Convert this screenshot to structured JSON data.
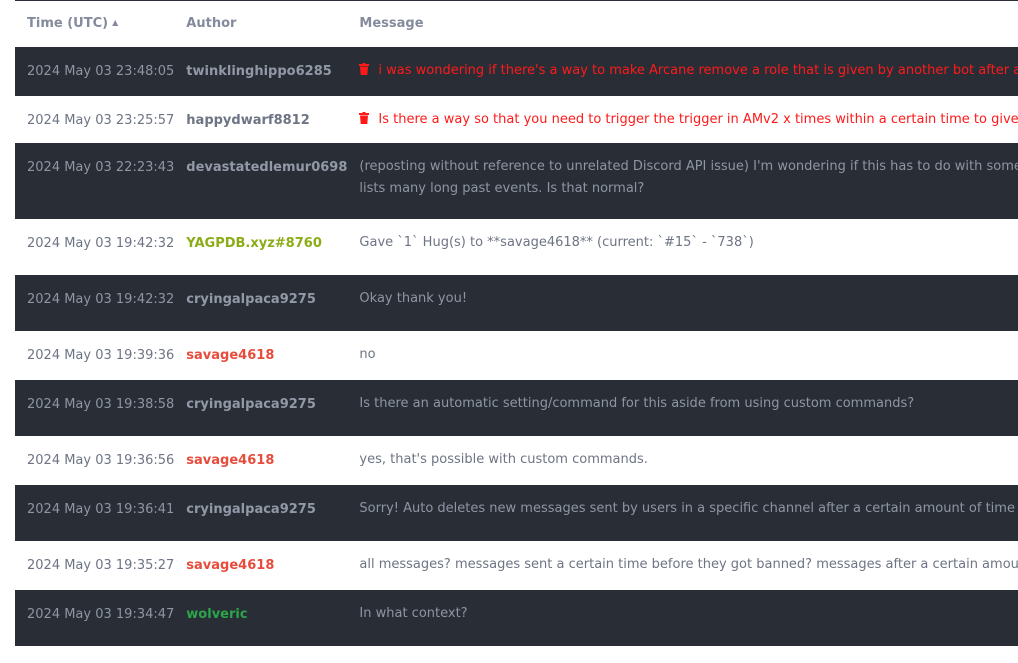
{
  "table": {
    "columns": [
      {
        "label": "Time (UTC)",
        "sort": "ascending",
        "sort_icon": "sort-up-icon"
      },
      {
        "label": "Author"
      },
      {
        "label": "Message"
      }
    ],
    "rows": [
      {
        "time": "2024 May 03 23:48:05",
        "author": "twinklinghippo6285",
        "author_color": "default",
        "deleted": true,
        "message": [
          "i was wondering if there's a way to make Arcane remove a role that is given by another bot after a user levels"
        ]
      },
      {
        "time": "2024 May 03 23:25:57",
        "author": "happydwarf8812",
        "author_color": "default",
        "deleted": true,
        "message": [
          "Is there a way so that you need to trigger the trigger in AMv2 x times within a certain time to give out the effe"
        ]
      },
      {
        "time": "2024 May 03 22:23:43",
        "author": "devastatedlemur0698",
        "author_color": "default",
        "deleted": false,
        "message": [
          "(reposting without reference to unrelated Discord API issue) I'm wondering if this has to do with something getti",
          "lists many long past events. Is that normal?"
        ]
      },
      {
        "time": "2024 May 03 19:42:32",
        "author": "YAGPDB.xyz#8760",
        "author_color": "#8cac17",
        "deleted": false,
        "message": [
          "Gave `1` Hug(s) to **savage4618** (current: `#15` - `738`)"
        ]
      },
      {
        "time": "2024 May 03 19:42:32",
        "author": "cryingalpaca9275",
        "author_color": "default",
        "deleted": false,
        "message": [
          "Okay thank you!"
        ]
      },
      {
        "time": "2024 May 03 19:39:36",
        "author": "savage4618",
        "author_color": "#e74c3c",
        "deleted": false,
        "message": [
          "no"
        ]
      },
      {
        "time": "2024 May 03 19:38:58",
        "author": "cryingalpaca9275",
        "author_color": "default",
        "deleted": false,
        "message": [
          "Is there an automatic setting/command for this aside from using custom commands?"
        ]
      },
      {
        "time": "2024 May 03 19:36:56",
        "author": "savage4618",
        "author_color": "#e74c3c",
        "deleted": false,
        "message": [
          "yes, that's possible with custom commands."
        ]
      },
      {
        "time": "2024 May 03 19:36:41",
        "author": "cryingalpaca9275",
        "author_color": "default",
        "deleted": false,
        "message": [
          "Sorry! Auto deletes new messages sent by users in a specific channel after a certain amount of time since sent"
        ]
      },
      {
        "time": "2024 May 03 19:35:27",
        "author": "savage4618",
        "author_color": "#e74c3c",
        "deleted": false,
        "message": [
          "all messages? messages sent a certain time before they got banned? messages after a certain amount of time si"
        ]
      },
      {
        "time": "2024 May 03 19:34:47",
        "author": "wolveric",
        "author_color": "#2ba54a",
        "deleted": false,
        "message": [
          "In what context?"
        ]
      }
    ]
  },
  "colors": {
    "dark_row": "#292d36",
    "light_row": "#ffffff",
    "deleted_text": "#ff1a1a",
    "header_text": "#848b9c"
  }
}
